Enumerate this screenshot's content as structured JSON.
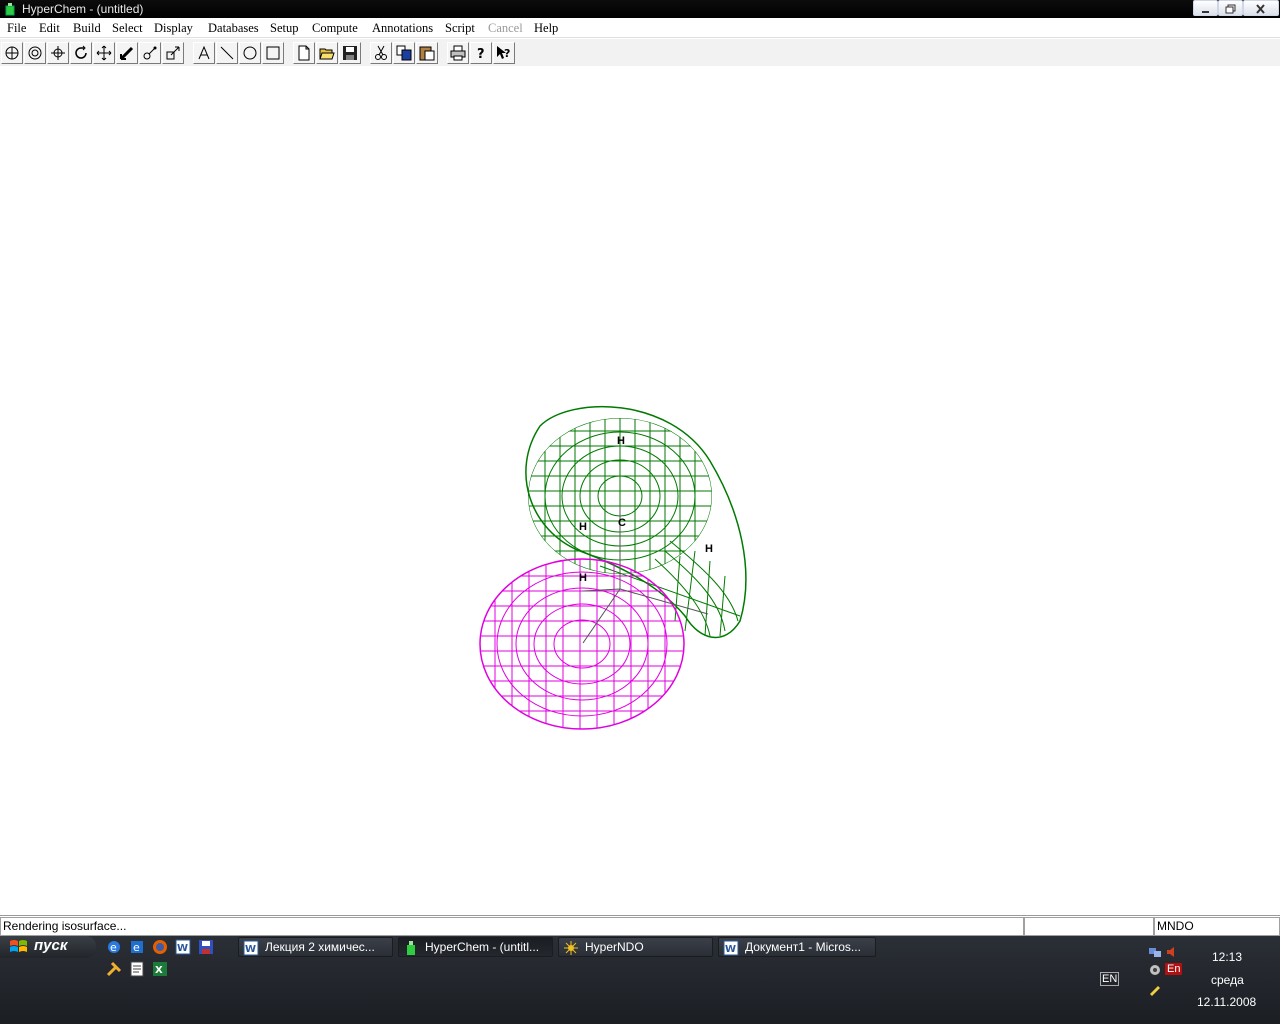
{
  "window": {
    "title": "HyperChem - (untitled)"
  },
  "menu": {
    "items": [
      "File",
      "Edit",
      "Build",
      "Select",
      "Display",
      "Databases",
      "Setup",
      "Compute",
      "Annotations",
      "Script",
      "Cancel",
      "Help"
    ],
    "disabled": [
      "Cancel"
    ]
  },
  "toolbar": {
    "tools": [
      "draw-tool-icon",
      "select-tool-icon",
      "rotate-xy-icon",
      "rotate-z-icon",
      "translate-xy-icon",
      "translate-z-icon",
      "zoom-icon",
      "z-clip-icon",
      "text-tool-icon",
      "line-tool-icon",
      "ellipse-tool-icon",
      "rectangle-tool-icon",
      "new-file-icon",
      "open-file-icon",
      "save-icon",
      "cut-icon",
      "copy-icon",
      "paste-icon",
      "print-icon",
      "help-icon",
      "context-help-icon"
    ]
  },
  "molecule": {
    "atoms": [
      "H",
      "H",
      "C",
      "H",
      "H"
    ],
    "lobe_colors": {
      "positive": "#007a00",
      "negative": "#e000e0"
    }
  },
  "status": {
    "message": "Rendering isosurface...",
    "middle": "",
    "method": "MNDO"
  },
  "taskbar": {
    "start_label": "пуск",
    "tasks": [
      {
        "label": "Лекция 2 химичес...",
        "icon": "word-icon"
      },
      {
        "label": "HyperChem - (untitl...",
        "icon": "hyperchem-icon"
      },
      {
        "label": "HyperNDO",
        "icon": "hyperndo-icon"
      },
      {
        "label": "Документ1 - Micros...",
        "icon": "word-icon"
      }
    ],
    "tray": {
      "lang": "EN",
      "lang2": "En",
      "time": "12:13",
      "day": "среда",
      "date": "12.11.2008"
    }
  }
}
